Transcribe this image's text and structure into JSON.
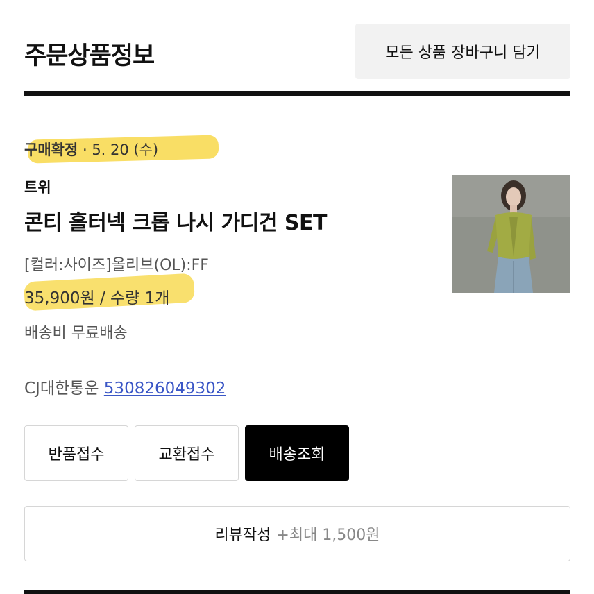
{
  "header": {
    "title": "주문상품정보",
    "add_all_to_cart": "모든 상품 장바구니 담기"
  },
  "order": {
    "status_label": "구매확정",
    "status_separator": " · ",
    "status_date": "5. 20 (수)",
    "brand": "트위",
    "product_name": "콘티 홀터넥 크롭 나시 가디건 SET",
    "option": "[컬러:사이즈]올리브(OL):FF",
    "price_quantity": "35,900원 / 수량 1개",
    "shipping_fee": "배송비 무료배송",
    "courier": "CJ대한통운",
    "tracking_number": "530826049302"
  },
  "actions": {
    "return_label": "반품접수",
    "exchange_label": "교환접수",
    "track_label": "배송조회",
    "review_label": "리뷰작성",
    "review_reward": "+최대 1,500원"
  },
  "colors": {
    "highlight": "#f8d84a",
    "link": "#3a56c6",
    "primary_button": "#000000",
    "secondary_button_bg": "#f2f2f2"
  }
}
